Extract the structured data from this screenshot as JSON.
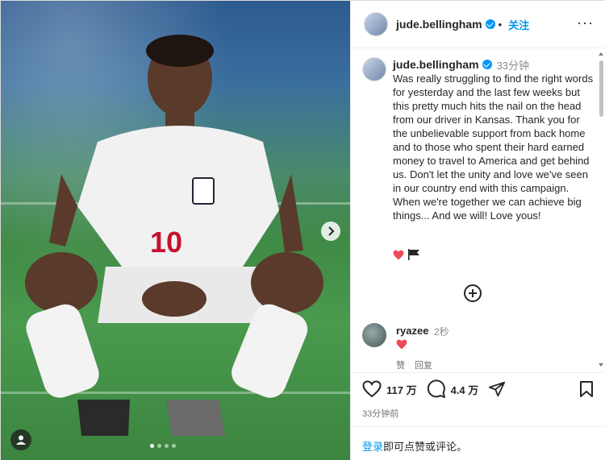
{
  "post": {
    "username": "jude.bellingham",
    "follow_label": "关注",
    "more_label": "···",
    "caption_time": "33分钟",
    "caption": "Was really struggling to find the right words for yesterday and the last few weeks but this pretty much hits the nail on the head from our driver in Kansas. Thank you for the unbelievable support from back home and to those who spent their hard earned money to travel to America and get behind us. Don't let the unity and love we've seen in our country end with this campaign. When we're together we can achieve big things... And we will! Love yous!",
    "emojis": [
      "red-heart-icon",
      "black-flag-icon"
    ]
  },
  "comments": [
    {
      "username": "ryazee",
      "time": "2秒",
      "content_icon": "red-heart-icon",
      "like_label": "赞",
      "reply_label": "回复"
    }
  ],
  "actions": {
    "likes": "117 万",
    "comments": "4.4 万"
  },
  "posted_ago": "33分钟前",
  "login_prompt": {
    "link": "登录",
    "text": "即可点赞或评论。"
  },
  "carousel": {
    "dot_count": 4,
    "active_index": 0
  },
  "colors": {
    "accent": "#0095f6",
    "heart": "#ed4956",
    "text": "#262626",
    "muted": "#8e8e8e"
  }
}
